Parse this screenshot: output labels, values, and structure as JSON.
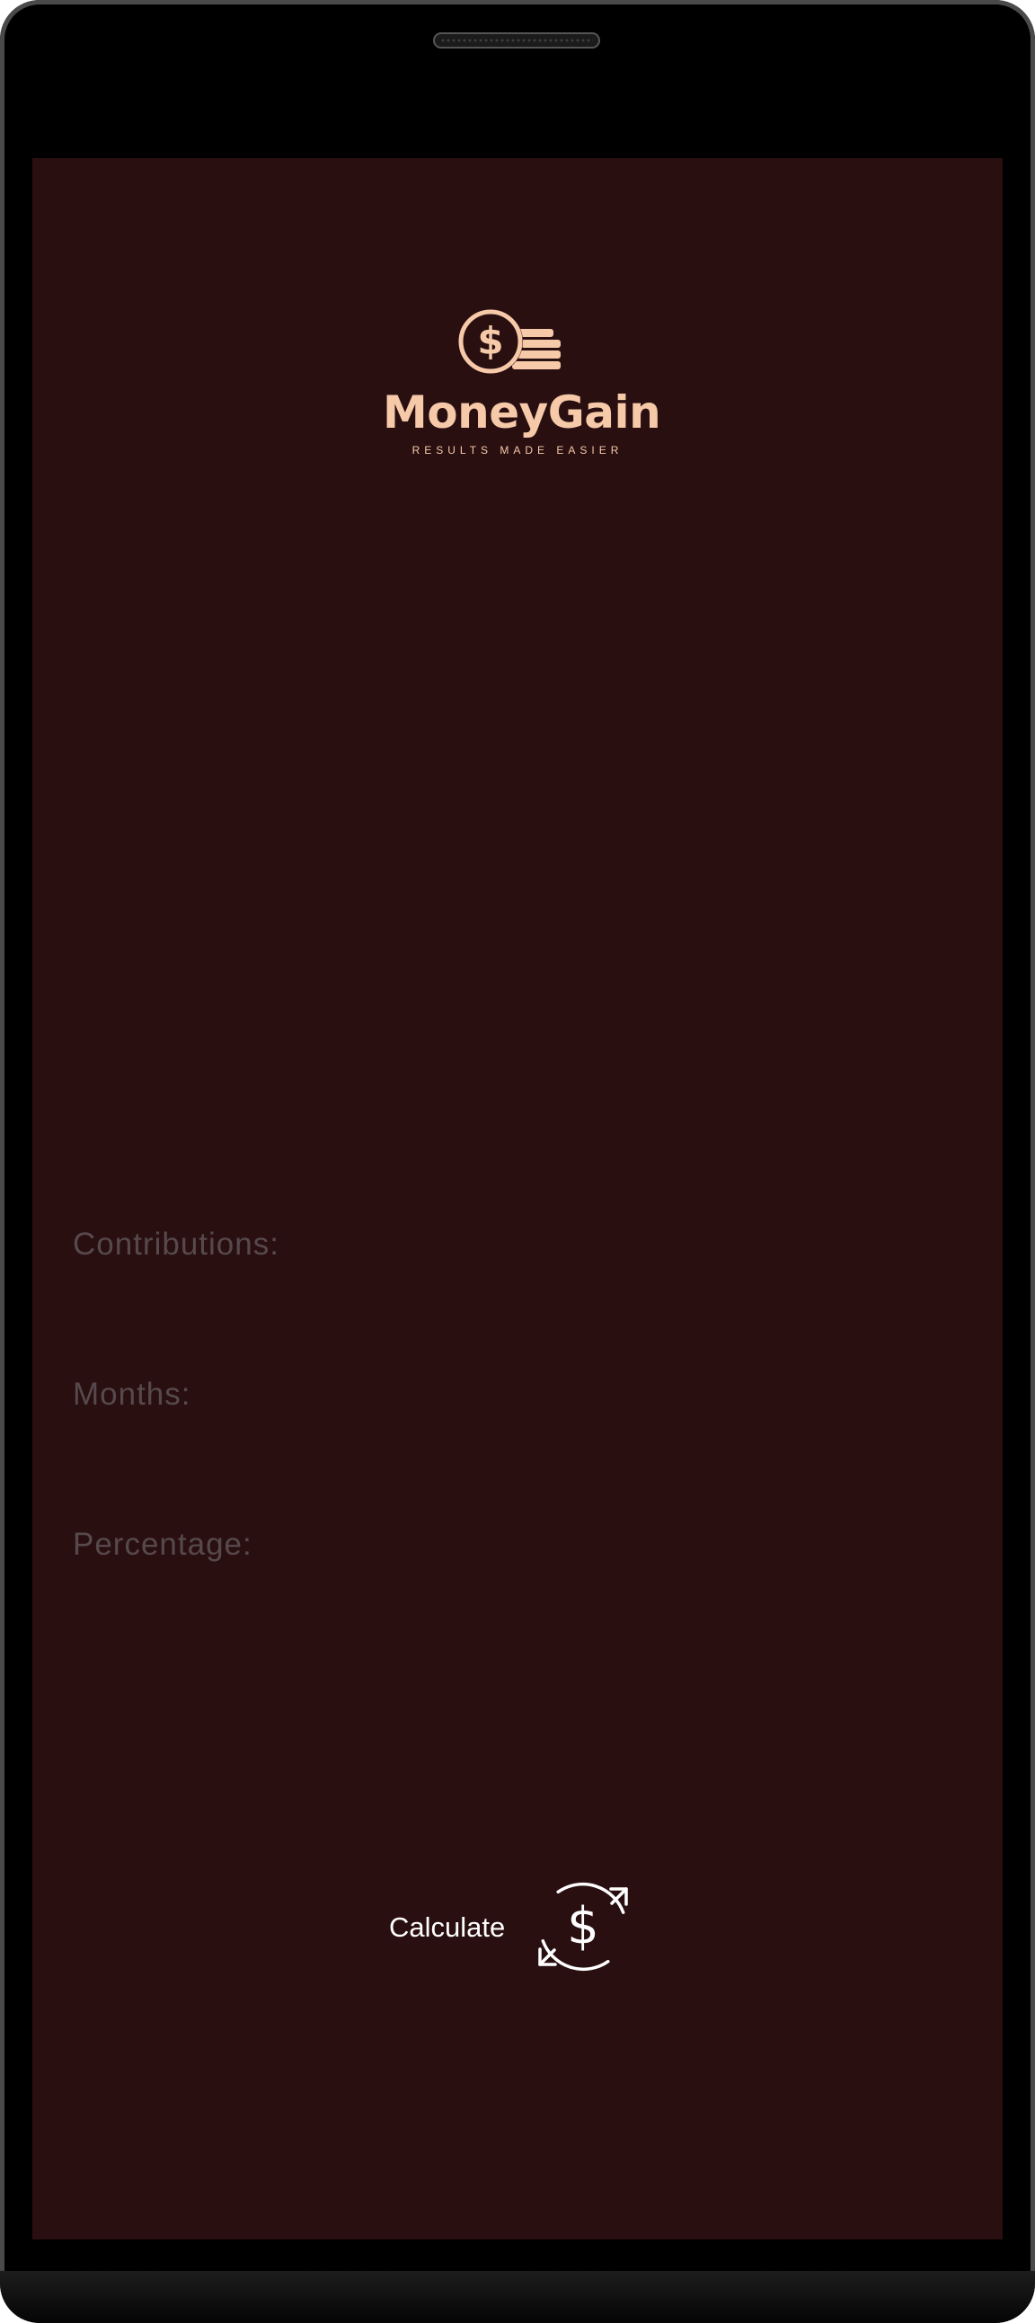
{
  "brand": {
    "name": "MoneyGain",
    "tagline": "RESULTS MADE EASIER",
    "logo_icon": "dollar-coins-icon",
    "color": "#f6c9a9"
  },
  "form": {
    "fields": [
      {
        "label": "Contributions:"
      },
      {
        "label": "Months:"
      },
      {
        "label": "Percentage:"
      }
    ]
  },
  "actions": {
    "calculate_label": "Calculate",
    "calculate_icon": "dollar-sync-icon"
  },
  "colors": {
    "background": "#2a0f11",
    "label": "#56494c",
    "button_text": "#ffffff"
  }
}
